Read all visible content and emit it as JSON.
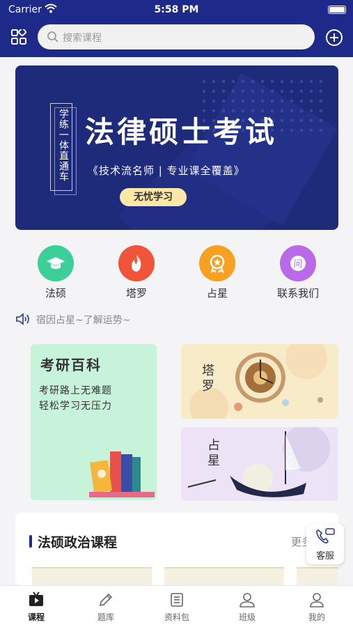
{
  "status_bar": {
    "carrier": "Carrier",
    "time": "5:58 PM"
  },
  "search": {
    "placeholder": "搜索课程"
  },
  "banner": {
    "vertical_text": "学练一体直通车",
    "title": "法律硕士考试",
    "subtitle": "《技术流名师 | 专业课全覆盖》",
    "button": "无忧学习"
  },
  "categories": [
    {
      "label": "法硕",
      "icon": "graduation-cap-icon",
      "color": "#3ccf9a"
    },
    {
      "label": "塔罗",
      "icon": "flame-icon",
      "color": "#f0553a"
    },
    {
      "label": "占星",
      "icon": "badge-icon",
      "color": "#f8a022"
    },
    {
      "label": "联系我们",
      "icon": "question-icon",
      "color": "#b86ae8"
    }
  ],
  "notice": {
    "text": "宿因占星~了解运势~"
  },
  "kaoyan_card": {
    "title": "考研百科",
    "line1": "考研路上无难题",
    "line2": "轻松学习无压力"
  },
  "tarot_card": {
    "label": "塔罗"
  },
  "astro_card": {
    "label": "占星"
  },
  "course_section": {
    "title": "法硕政治课程",
    "more": "更多"
  },
  "service": {
    "label": "客服"
  },
  "tabs": [
    {
      "label": "课程",
      "icon": "play-tv-icon",
      "active": true
    },
    {
      "label": "题库",
      "icon": "pencil-icon",
      "active": false
    },
    {
      "label": "资料包",
      "icon": "document-list-icon",
      "active": false
    },
    {
      "label": "班级",
      "icon": "people-icon",
      "active": false
    },
    {
      "label": "我的",
      "icon": "person-icon",
      "active": false
    }
  ],
  "colors": {
    "brand": "#1e2a8a",
    "banner_button": "#fbe7a6",
    "card_green": "#c7f3da"
  }
}
